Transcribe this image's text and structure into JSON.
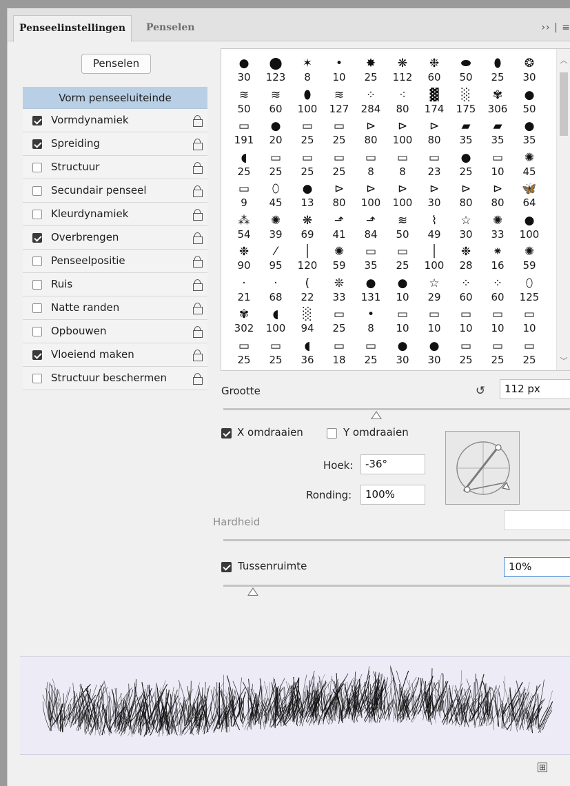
{
  "tabs": {
    "active": "Penseelinstellingen",
    "inactive": "Penselen",
    "menu": "›› | ≡"
  },
  "penselen_button": "Penselen",
  "options": [
    {
      "label": "Vorm penseeluiteinde",
      "header": true
    },
    {
      "label": "Vormdynamiek",
      "checked": true
    },
    {
      "label": "Spreiding",
      "checked": true
    },
    {
      "label": "Structuur",
      "checked": false
    },
    {
      "label": "Secundair penseel",
      "checked": false
    },
    {
      "label": "Kleurdynamiek",
      "checked": false
    },
    {
      "label": "Overbrengen",
      "checked": true
    },
    {
      "label": "Penseelpositie",
      "checked": false
    },
    {
      "label": "Ruis",
      "checked": false
    },
    {
      "label": "Natte randen",
      "checked": false
    },
    {
      "label": "Opbouwen",
      "checked": false
    },
    {
      "label": "Vloeiend maken",
      "checked": true
    },
    {
      "label": "Structuur beschermen",
      "checked": false
    }
  ],
  "brush_sizes": [
    "30",
    "123",
    "8",
    "10",
    "25",
    "112",
    "60",
    "50",
    "25",
    "30",
    "50",
    "60",
    "100",
    "127",
    "284",
    "80",
    "174",
    "175",
    "306",
    "50",
    "191",
    "20",
    "25",
    "25",
    "80",
    "100",
    "80",
    "35",
    "35",
    "35",
    "25",
    "25",
    "25",
    "25",
    "8",
    "8",
    "23",
    "25",
    "10",
    "45",
    "9",
    "45",
    "13",
    "80",
    "100",
    "100",
    "30",
    "80",
    "80",
    "64",
    "54",
    "39",
    "69",
    "41",
    "84",
    "50",
    "49",
    "30",
    "33",
    "100",
    "90",
    "95",
    "120",
    "59",
    "35",
    "25",
    "100",
    "28",
    "16",
    "59",
    "21",
    "68",
    "22",
    "33",
    "131",
    "10",
    "29",
    "60",
    "60",
    "125",
    "302",
    "100",
    "94",
    "25",
    "8",
    "10",
    "10",
    "10",
    "10",
    "10",
    "25",
    "25",
    "36",
    "18",
    "25",
    "30",
    "30",
    "25",
    "25",
    "25"
  ],
  "brush_glyphs": [
    "●",
    "⬤",
    "✶",
    "•",
    "✸",
    "❋",
    "❉",
    "⬬",
    "⬮",
    "❂",
    "≋",
    "≋",
    "⬮",
    "≋",
    "⁘",
    "⁖",
    "▓",
    "░",
    "✾",
    "●",
    "▭",
    "●",
    "▭",
    "▭",
    "⊳",
    "⊳",
    "⊳",
    "▰",
    "▰",
    "●",
    "◖",
    "▭",
    "▭",
    "▭",
    "▭",
    "▭",
    "▭",
    "●",
    "▭",
    "✺",
    "▭",
    "⬯",
    "●",
    "⊳",
    "⊳",
    "⊳",
    "⊳",
    "⊳",
    "⊳",
    "🦋",
    "⁂",
    "✺",
    "❋",
    "⬏",
    "⬏",
    "≋",
    "⌇",
    "☆",
    "✺",
    "●",
    "❉",
    "⁄",
    "│",
    "✺",
    "▭",
    "▭",
    "│",
    "❉",
    "⁕",
    "✺",
    "·",
    "·",
    "(",
    "❊",
    "●",
    "●",
    "☆",
    "⁘",
    "⁘",
    "⬯",
    "✾",
    "◖",
    "░",
    "▭",
    "•",
    "▭",
    "▭",
    "▭",
    "▭",
    "▭",
    "▭",
    "▭",
    "◖",
    "▭",
    "▭",
    "●",
    "●",
    "▭",
    "▭",
    "▭"
  ],
  "size": {
    "label": "Grootte",
    "value": "112 px",
    "slider_fraction": 0.44
  },
  "flip": {
    "x_label": "X omdraaien",
    "x_checked": true,
    "y_label": "Y omdraaien",
    "y_checked": false
  },
  "angle": {
    "label": "Hoek:",
    "value": "-36°"
  },
  "roundness": {
    "label": "Ronding:",
    "value": "100%"
  },
  "hardness": {
    "label": "Hardheid",
    "value": ""
  },
  "spacing": {
    "label": "Tussenruimte",
    "value": "10%",
    "checked": true,
    "slider_fraction": 0.05
  },
  "footer": {
    "new_button": "⊞"
  }
}
